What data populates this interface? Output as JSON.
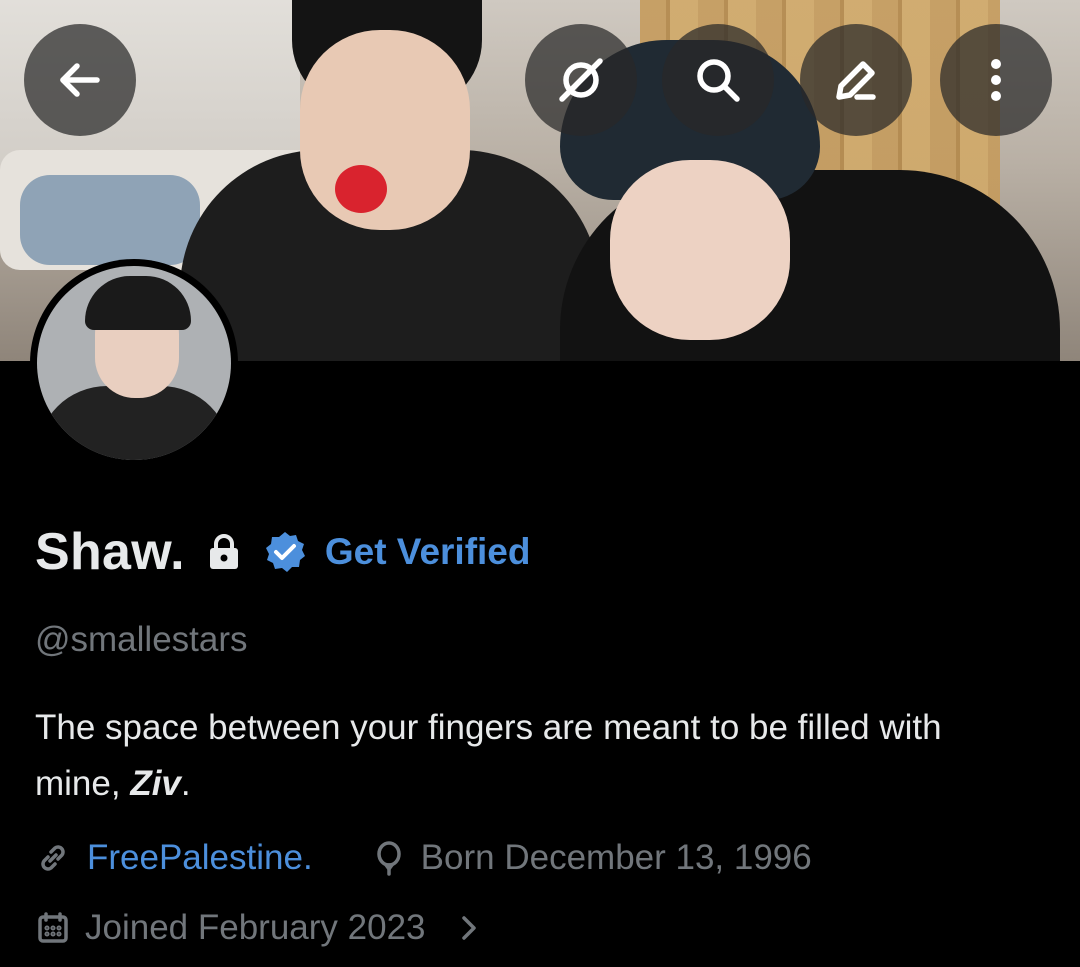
{
  "header": {
    "back_icon": "arrow-left-icon",
    "grok_icon": "grok-icon",
    "search_icon": "search-icon",
    "edit_icon": "pencil-icon",
    "more_icon": "more-vertical-icon"
  },
  "profile": {
    "name": "Shaw.",
    "protected_icon": "lock-icon",
    "verified_icon": "verified-badge-icon",
    "get_verified_label": "Get Verified",
    "handle": "@smallestars",
    "bio_text": "The space between your fingers are meant to be filled with mine, ",
    "bio_bold": "Ziv",
    "bio_end": ".",
    "website": "FreePalestine.",
    "birthday": "Born December 13, 1996",
    "joined": "Joined February 2023"
  },
  "colors": {
    "accent": "#4c8fdc",
    "muted": "#71767b",
    "text": "#e7e9ea",
    "background": "#000000"
  }
}
